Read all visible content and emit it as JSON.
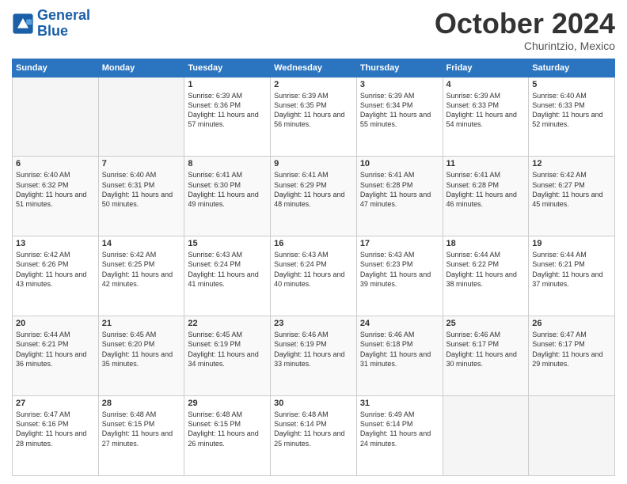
{
  "logo": {
    "line1": "General",
    "line2": "Blue"
  },
  "header": {
    "month": "October 2024",
    "location": "Churintzio, Mexico"
  },
  "weekdays": [
    "Sunday",
    "Monday",
    "Tuesday",
    "Wednesday",
    "Thursday",
    "Friday",
    "Saturday"
  ],
  "weeks": [
    [
      {
        "day": "",
        "info": ""
      },
      {
        "day": "",
        "info": ""
      },
      {
        "day": "1",
        "info": "Sunrise: 6:39 AM\nSunset: 6:36 PM\nDaylight: 11 hours and 57 minutes."
      },
      {
        "day": "2",
        "info": "Sunrise: 6:39 AM\nSunset: 6:35 PM\nDaylight: 11 hours and 56 minutes."
      },
      {
        "day": "3",
        "info": "Sunrise: 6:39 AM\nSunset: 6:34 PM\nDaylight: 11 hours and 55 minutes."
      },
      {
        "day": "4",
        "info": "Sunrise: 6:39 AM\nSunset: 6:33 PM\nDaylight: 11 hours and 54 minutes."
      },
      {
        "day": "5",
        "info": "Sunrise: 6:40 AM\nSunset: 6:33 PM\nDaylight: 11 hours and 52 minutes."
      }
    ],
    [
      {
        "day": "6",
        "info": "Sunrise: 6:40 AM\nSunset: 6:32 PM\nDaylight: 11 hours and 51 minutes."
      },
      {
        "day": "7",
        "info": "Sunrise: 6:40 AM\nSunset: 6:31 PM\nDaylight: 11 hours and 50 minutes."
      },
      {
        "day": "8",
        "info": "Sunrise: 6:41 AM\nSunset: 6:30 PM\nDaylight: 11 hours and 49 minutes."
      },
      {
        "day": "9",
        "info": "Sunrise: 6:41 AM\nSunset: 6:29 PM\nDaylight: 11 hours and 48 minutes."
      },
      {
        "day": "10",
        "info": "Sunrise: 6:41 AM\nSunset: 6:28 PM\nDaylight: 11 hours and 47 minutes."
      },
      {
        "day": "11",
        "info": "Sunrise: 6:41 AM\nSunset: 6:28 PM\nDaylight: 11 hours and 46 minutes."
      },
      {
        "day": "12",
        "info": "Sunrise: 6:42 AM\nSunset: 6:27 PM\nDaylight: 11 hours and 45 minutes."
      }
    ],
    [
      {
        "day": "13",
        "info": "Sunrise: 6:42 AM\nSunset: 6:26 PM\nDaylight: 11 hours and 43 minutes."
      },
      {
        "day": "14",
        "info": "Sunrise: 6:42 AM\nSunset: 6:25 PM\nDaylight: 11 hours and 42 minutes."
      },
      {
        "day": "15",
        "info": "Sunrise: 6:43 AM\nSunset: 6:24 PM\nDaylight: 11 hours and 41 minutes."
      },
      {
        "day": "16",
        "info": "Sunrise: 6:43 AM\nSunset: 6:24 PM\nDaylight: 11 hours and 40 minutes."
      },
      {
        "day": "17",
        "info": "Sunrise: 6:43 AM\nSunset: 6:23 PM\nDaylight: 11 hours and 39 minutes."
      },
      {
        "day": "18",
        "info": "Sunrise: 6:44 AM\nSunset: 6:22 PM\nDaylight: 11 hours and 38 minutes."
      },
      {
        "day": "19",
        "info": "Sunrise: 6:44 AM\nSunset: 6:21 PM\nDaylight: 11 hours and 37 minutes."
      }
    ],
    [
      {
        "day": "20",
        "info": "Sunrise: 6:44 AM\nSunset: 6:21 PM\nDaylight: 11 hours and 36 minutes."
      },
      {
        "day": "21",
        "info": "Sunrise: 6:45 AM\nSunset: 6:20 PM\nDaylight: 11 hours and 35 minutes."
      },
      {
        "day": "22",
        "info": "Sunrise: 6:45 AM\nSunset: 6:19 PM\nDaylight: 11 hours and 34 minutes."
      },
      {
        "day": "23",
        "info": "Sunrise: 6:46 AM\nSunset: 6:19 PM\nDaylight: 11 hours and 33 minutes."
      },
      {
        "day": "24",
        "info": "Sunrise: 6:46 AM\nSunset: 6:18 PM\nDaylight: 11 hours and 31 minutes."
      },
      {
        "day": "25",
        "info": "Sunrise: 6:46 AM\nSunset: 6:17 PM\nDaylight: 11 hours and 30 minutes."
      },
      {
        "day": "26",
        "info": "Sunrise: 6:47 AM\nSunset: 6:17 PM\nDaylight: 11 hours and 29 minutes."
      }
    ],
    [
      {
        "day": "27",
        "info": "Sunrise: 6:47 AM\nSunset: 6:16 PM\nDaylight: 11 hours and 28 minutes."
      },
      {
        "day": "28",
        "info": "Sunrise: 6:48 AM\nSunset: 6:15 PM\nDaylight: 11 hours and 27 minutes."
      },
      {
        "day": "29",
        "info": "Sunrise: 6:48 AM\nSunset: 6:15 PM\nDaylight: 11 hours and 26 minutes."
      },
      {
        "day": "30",
        "info": "Sunrise: 6:48 AM\nSunset: 6:14 PM\nDaylight: 11 hours and 25 minutes."
      },
      {
        "day": "31",
        "info": "Sunrise: 6:49 AM\nSunset: 6:14 PM\nDaylight: 11 hours and 24 minutes."
      },
      {
        "day": "",
        "info": ""
      },
      {
        "day": "",
        "info": ""
      }
    ]
  ]
}
